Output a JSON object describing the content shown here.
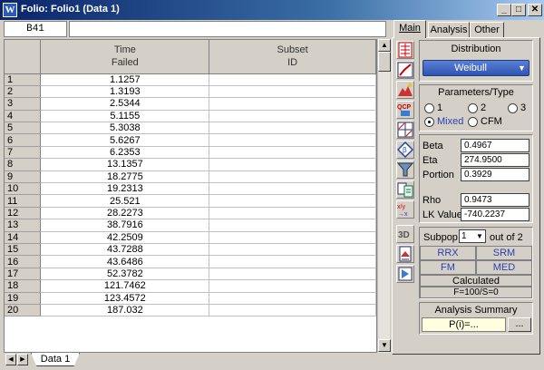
{
  "window": {
    "title": "Folio: Folio1 (Data 1)",
    "app_icon": "W",
    "controls": [
      "minimize",
      "maximize",
      "close"
    ]
  },
  "cell_reference": "B41",
  "formula_value": "",
  "grid": {
    "columns": [
      {
        "line1": "Time",
        "line2": "Failed"
      },
      {
        "line1": "Subset",
        "line2": "ID"
      }
    ],
    "rows": [
      {
        "n": "1",
        "time": "1.1257",
        "subset": ""
      },
      {
        "n": "2",
        "time": "1.3193",
        "subset": ""
      },
      {
        "n": "3",
        "time": "2.5344",
        "subset": ""
      },
      {
        "n": "4",
        "time": "5.1155",
        "subset": ""
      },
      {
        "n": "5",
        "time": "5.3038",
        "subset": ""
      },
      {
        "n": "6",
        "time": "5.6267",
        "subset": ""
      },
      {
        "n": "7",
        "time": "6.2353",
        "subset": ""
      },
      {
        "n": "8",
        "time": "13.1357",
        "subset": ""
      },
      {
        "n": "9",
        "time": "18.2775",
        "subset": ""
      },
      {
        "n": "10",
        "time": "19.2313",
        "subset": ""
      },
      {
        "n": "11",
        "time": "25.521",
        "subset": ""
      },
      {
        "n": "12",
        "time": "28.2273",
        "subset": ""
      },
      {
        "n": "13",
        "time": "38.7916",
        "subset": ""
      },
      {
        "n": "14",
        "time": "42.2509",
        "subset": ""
      },
      {
        "n": "15",
        "time": "43.7288",
        "subset": ""
      },
      {
        "n": "16",
        "time": "43.6486",
        "subset": ""
      },
      {
        "n": "17",
        "time": "52.3782",
        "subset": ""
      },
      {
        "n": "18",
        "time": "121.7462",
        "subset": ""
      },
      {
        "n": "19",
        "time": "123.4572",
        "subset": ""
      },
      {
        "n": "20",
        "time": "187.032",
        "subset": ""
      }
    ]
  },
  "sheet_tab": "Data 1",
  "tabs": [
    "Main",
    "Analysis",
    "Other"
  ],
  "panel": {
    "distribution": {
      "title": "Distribution",
      "selected": "Weibull"
    },
    "parameters_type": {
      "title": "Parameters/Type",
      "options": [
        "1",
        "2",
        "3",
        "Mixed",
        "CFM"
      ],
      "selected": "Mixed"
    },
    "params": {
      "beta_label": "Beta",
      "beta": "0.4967",
      "eta_label": "Eta",
      "eta": "274.9500",
      "portion_label": "Portion",
      "portion": "0.3929",
      "rho_label": "Rho",
      "rho": "0.9473",
      "lk_label": "LK Value",
      "lk": "-740.2237"
    },
    "subpop": {
      "label": "Subpop",
      "value": "1",
      "out_of": "out of 2"
    },
    "methods": [
      "RRX",
      "SRM",
      "FM",
      "MED"
    ],
    "calculated": "Calculated",
    "fs": "F=100/S=0",
    "analysis_summary": {
      "title": "Analysis Summary",
      "value": "P(i)=...",
      "more": "..."
    }
  },
  "toolbar_icons": [
    "folio-icon",
    "plot-icon",
    "mountain-icon",
    "qcp-icon",
    "batch-plot-icon",
    "parameter-tool-icon",
    "filter-icon",
    "transfer-icon",
    "transform-icon",
    "3d-plot-icon",
    "report-icon",
    "publish-icon"
  ]
}
